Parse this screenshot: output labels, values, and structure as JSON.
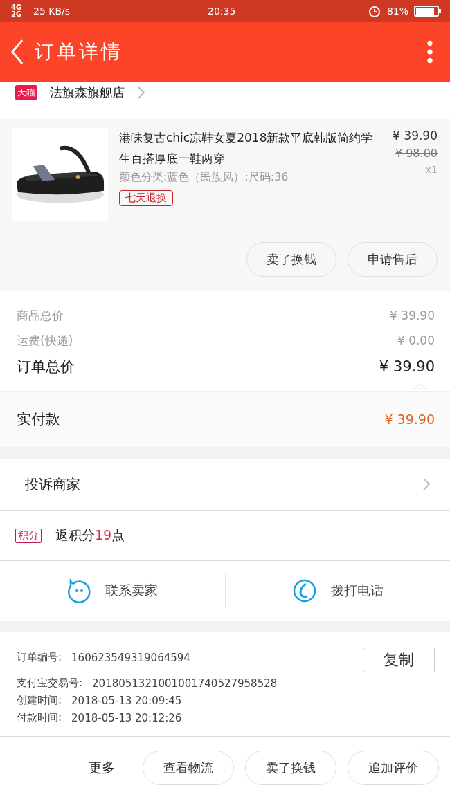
{
  "status_bar": {
    "network": "4G 2G",
    "speed": "25 KB/s",
    "time": "20:35",
    "battery": "81%"
  },
  "header": {
    "title": "订单详情"
  },
  "shop": {
    "badge": "天猫",
    "name": "法旗森旗舰店"
  },
  "product": {
    "title": "港味复古chic凉鞋女夏2018新款平底韩版简约学生百搭厚底一鞋两穿",
    "sku": "颜色分类:蓝色（民族风）;尺码:36",
    "tag": "七天退换",
    "price": "¥ 39.90",
    "original_price": "¥ 98.00",
    "quantity": "x1",
    "kind": "picture",
    "actions": [
      "卖了换钱",
      "申请售后"
    ]
  },
  "summary": {
    "rows": [
      {
        "kind": "minor",
        "label": "商品总价",
        "value": "¥ 39.90"
      },
      {
        "kind": "minor",
        "label": "运费(快递)",
        "value": "¥ 0.00"
      },
      {
        "kind": "major",
        "label": "订单总价",
        "value": "¥ 39.90"
      }
    ],
    "paid": {
      "label": "实付款",
      "value": "¥ 39.90"
    }
  },
  "complaint": {
    "label": "投诉商家"
  },
  "points": {
    "badge": "积分",
    "before": "返积分",
    "number": "19",
    "after": "点"
  },
  "contact": [
    {
      "kind": "chat",
      "label": "联系卖家"
    },
    {
      "kind": "phone",
      "label": "拨打电话"
    }
  ],
  "info": {
    "copy_button": "复制",
    "rows": [
      {
        "label": "订单编号:",
        "value": "160623549319064594"
      },
      {
        "label": "支付宝交易号:",
        "value": "2018051321001001740527958528"
      },
      {
        "label": "创建时间:",
        "value": "2018-05-13 20:09:45"
      },
      {
        "label": "付款时间:",
        "value": "2018-05-13 20:12:26"
      }
    ]
  },
  "bottom_bar": {
    "more": "更多",
    "buttons": [
      "查看物流",
      "卖了换钱",
      "追加评价"
    ]
  }
}
